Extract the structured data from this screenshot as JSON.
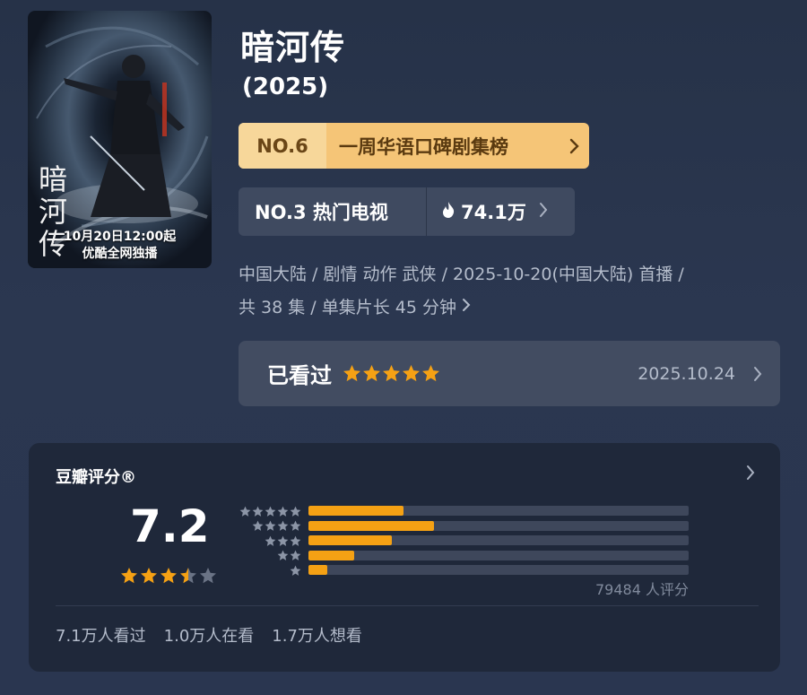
{
  "poster": {
    "calligraphy": "暗河传",
    "caption_line1": "10月20日12:00起",
    "caption_line2": "优酷全网独播"
  },
  "title": "暗河传",
  "year": "(2025)",
  "ranking": {
    "rank": "NO.6",
    "name": "一周华语口碑剧集榜"
  },
  "hot": {
    "rank_label": "NO.3 热门电视",
    "heat": "74.1万"
  },
  "meta": {
    "line1": "中国大陆 / 剧情 动作 武侠 / 2025-10-20(中国大陆) 首播 /",
    "line2": "共 38 集 / 单集片长 45 分钟"
  },
  "watched": {
    "label": "已看过",
    "stars": 5,
    "date": "2025.10.24"
  },
  "rating": {
    "title": "豆瓣评分®",
    "score": "7.2",
    "stars_value": 3.5,
    "votes": "79484 人评分",
    "distribution": [
      {
        "stars": 5,
        "fraction": 0.25
      },
      {
        "stars": 4,
        "fraction": 0.33
      },
      {
        "stars": 3,
        "fraction": 0.22
      },
      {
        "stars": 2,
        "fraction": 0.12
      },
      {
        "stars": 1,
        "fraction": 0.05
      }
    ]
  },
  "stats": {
    "watched": "7.1万人看过",
    "watching": "1.0万人在看",
    "wish": "1.7万人想看"
  },
  "colors": {
    "star_orange": "#f5a114",
    "rank_gold": "#f5c577",
    "background": "#263248",
    "card": "#1f283a"
  }
}
